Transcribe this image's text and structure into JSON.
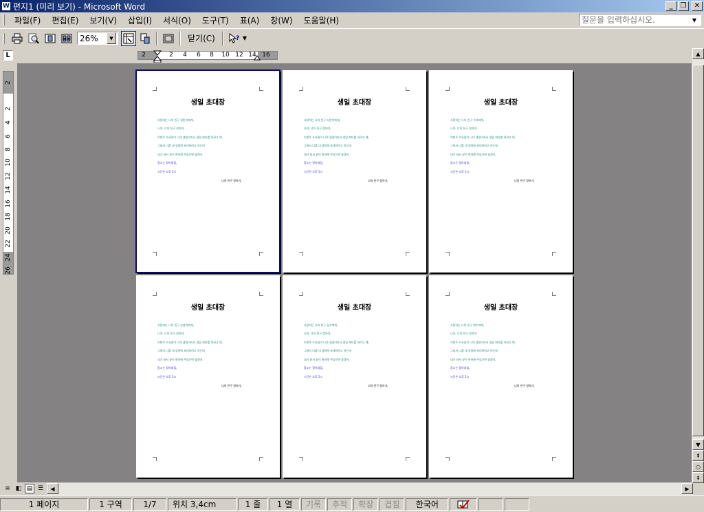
{
  "window": {
    "title": "편지1 (미리 보기) - Microsoft Word",
    "app_icon": "W"
  },
  "menu": {
    "items": [
      "파일(F)",
      "편집(E)",
      "보기(V)",
      "삽입(I)",
      "서식(O)",
      "도구(T)",
      "표(A)",
      "창(W)",
      "도움말(H)"
    ],
    "help_placeholder": "질문을 입력하십시오."
  },
  "toolbar": {
    "zoom_value": "26%",
    "close_label": "닫기(C)"
  },
  "ruler": {
    "h_ticks": [
      "2",
      "2",
      "4",
      "6",
      "8",
      "10",
      "12",
      "14",
      "16"
    ],
    "v_ticks": [
      "2",
      "2",
      "4",
      "6",
      "8",
      "10",
      "12",
      "14",
      "16",
      "18",
      "20",
      "22",
      "24",
      "26"
    ]
  },
  "pages": [
    {
      "title": "생일 초대장",
      "lines": [
        "사랑하는 나의 친구 경민이에게,",
        "나야, 너의 친구 정아야,",
        "이번주 수요일이 나의 생일이라서 생일 파티를 하려고 해,",
        "그래서 너를 내 생일에 초대하려고 하는데",
        "네가 와서 같이 축하해 주었으면 좋겠어,",
        "장소는 정아네집,",
        "시간은 오후 5시"
      ],
      "sign": "너의 친구 정아가,"
    },
    {
      "title": "생일 초대장",
      "lines": [
        "사랑하는 나의 친구 서연이에게,",
        "나야, 너의 친구 정아야,",
        "이번주 수요일이 나의 생일이라서 생일 파티를 하려고 해,",
        "그래서 너를 내 생일에 초대하려고 하는데",
        "네가 와서 같이 축하해 주었으면 좋겠어,",
        "장소는 정아네집,",
        "시간은 오후 5시"
      ],
      "sign": "너의 친구 정아가,"
    },
    {
      "title": "생일 초대장",
      "lines": [
        "사랑하는 나의 친구 수지에게,",
        "나야, 너의 친구 정아야,",
        "이번주 수요일이 나의 생일이라서 생일 파티를 하려고 해,",
        "그래서 너를 내 생일에 초대하려고 하는데",
        "네가 와서 같이 축하해 주었으면 좋겠어,",
        "장소는 정아네집,",
        "시간은 오후 5시"
      ],
      "sign": "너의 친구 정아가,"
    },
    {
      "title": "생일 초대장",
      "lines": [
        "사랑하는 나의 친구 은영이에게,",
        "나야, 너의 친구 정아야,",
        "이번주 수요일이 나의 생일이라서 생일 파티를 하려고 해,",
        "그래서 너를 내 생일에 초대하려고 하는데",
        "네가 와서 같이 축하해 주었으면 좋겠어,",
        "장소는 정아네집,",
        "시간은 오후 5시"
      ],
      "sign": "너의 친구 정아가,"
    },
    {
      "title": "생일 초대장",
      "lines": [
        "사랑하는 나의 친구 길수에게,",
        "나야, 너의 친구 정아야,",
        "이번주 수요일이 나의 생일이라서 생일 파티를 하려고 해,",
        "그래서 너를 내 생일에 초대하려고 하는데",
        "네가 와서 같이 축하해 주었으면 좋겠어,",
        "장소는 정아네집,",
        "시간은 오후 5시"
      ],
      "sign": "너의 친구 정아가,"
    },
    {
      "title": "생일 초대장",
      "lines": [
        "사랑하는 나의 친구 영수에게,",
        "나야, 너의 친구 정아야,",
        "이번주 수요일이 나의 생일이라서 생일 파티를 하려고 해,",
        "그래서 너를 내 생일에 초대하려고 하는데",
        "네가 와서 같이 축하해 주었으면 좋겠어,",
        "장소는 정아네집,",
        "시간은 오후 5시"
      ],
      "sign": "너의 친구 정아가,"
    }
  ],
  "status": {
    "page": "1 페이지",
    "section": "1 구역",
    "count": "1/7",
    "position": "위치 3,4cm",
    "line": "1 줄",
    "column": "1 열",
    "rec": "기록",
    "trk": "추적",
    "ext": "확장",
    "ovr": "겹침",
    "language": "한국어"
  }
}
